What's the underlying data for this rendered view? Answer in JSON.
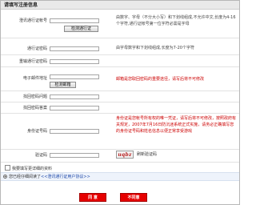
{
  "header": {
    "title": "请填写注册信息"
  },
  "fields": {
    "username": {
      "label": "澄讯通行证帐号",
      "check_button": "检测通行证"
    },
    "password": {
      "label": "通行证密码"
    },
    "repeat_password": {
      "label": "重输通行证密码"
    },
    "email": {
      "label": "电子邮件地址",
      "check_button": "检测邮箱"
    },
    "security_question": {
      "label": "找回密码问题"
    },
    "security_answer": {
      "label": "找回密码答案"
    },
    "id_number": {
      "label": "身份证号码"
    },
    "captcha": {
      "label": "验证码"
    }
  },
  "hints": {
    "username": "由数字、字母（不分大小写）和下划线组成,不允许中文,长度为4-16个字符,通行证帐号第一位字符必需是字母",
    "password": "由字母数字和下划线组成,长度为7-20个字符",
    "email": "邮箱是您取回密码的重要途径，请写后将不可修改",
    "id_number": "身份证是您帐号所有权的唯一凭证，请写后将不可修改，按照政府有关规定，2007年7月16日防沉迷系统正式实施，请务必正确填写您的身份证号码和姓名信息以便正常享受游戏",
    "captcha_refresh": "刷新验证码"
  },
  "captcha_image_text": "uqbz",
  "details_checkbox": {
    "label": "我要填写更详细的资料",
    "checked": false
  },
  "agree": {
    "prefix": "您已经仔细阅读了",
    "link": "<<澄讯通行证用户协议>>",
    "selected": true
  },
  "buttons": {
    "agree": "同 意",
    "disagree": "不同意"
  },
  "colors": {
    "accent": "#e60000",
    "hint_red": "#cc0000",
    "link": "#1b46a8"
  }
}
